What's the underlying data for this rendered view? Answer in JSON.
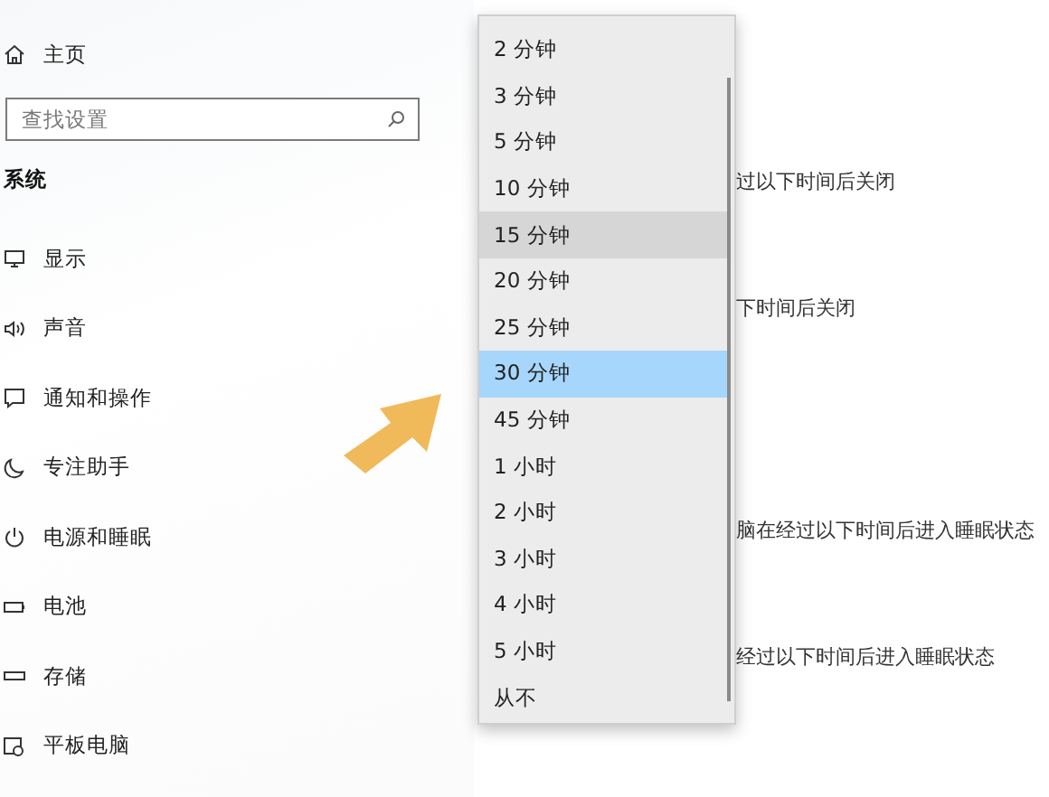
{
  "sidebar": {
    "home": {
      "label": "主页"
    },
    "search": {
      "placeholder": "查找设置"
    },
    "section_title": "系统",
    "items": [
      {
        "label": "显示"
      },
      {
        "label": "声音"
      },
      {
        "label": "通知和操作"
      },
      {
        "label": "专注助手"
      },
      {
        "label": "电源和睡眠"
      },
      {
        "label": "电池"
      },
      {
        "label": "存储"
      },
      {
        "label": "平板电脑"
      }
    ]
  },
  "dropdown": {
    "options": [
      {
        "label": "2 分钟",
        "selected": false,
        "hovered": false
      },
      {
        "label": "3 分钟",
        "selected": false,
        "hovered": false
      },
      {
        "label": "5 分钟",
        "selected": false,
        "hovered": false
      },
      {
        "label": "10 分钟",
        "selected": false,
        "hovered": false
      },
      {
        "label": "15 分钟",
        "selected": false,
        "hovered": true
      },
      {
        "label": "20 分钟",
        "selected": false,
        "hovered": false
      },
      {
        "label": "25 分钟",
        "selected": false,
        "hovered": false
      },
      {
        "label": "30 分钟",
        "selected": true,
        "hovered": false
      },
      {
        "label": "45 分钟",
        "selected": false,
        "hovered": false
      },
      {
        "label": "1 小时",
        "selected": false,
        "hovered": false
      },
      {
        "label": "2 小时",
        "selected": false,
        "hovered": false
      },
      {
        "label": "3 小时",
        "selected": false,
        "hovered": false
      },
      {
        "label": "4 小时",
        "selected": false,
        "hovered": false
      },
      {
        "label": "5 小时",
        "selected": false,
        "hovered": false
      },
      {
        "label": "从不",
        "selected": false,
        "hovered": false
      }
    ]
  },
  "content": {
    "labels": [
      "过以下时间后关闭",
      "下时间后关闭",
      "脑在经过以下时间后进入睡眠状态",
      "经过以下时间后进入睡眠状态"
    ]
  }
}
